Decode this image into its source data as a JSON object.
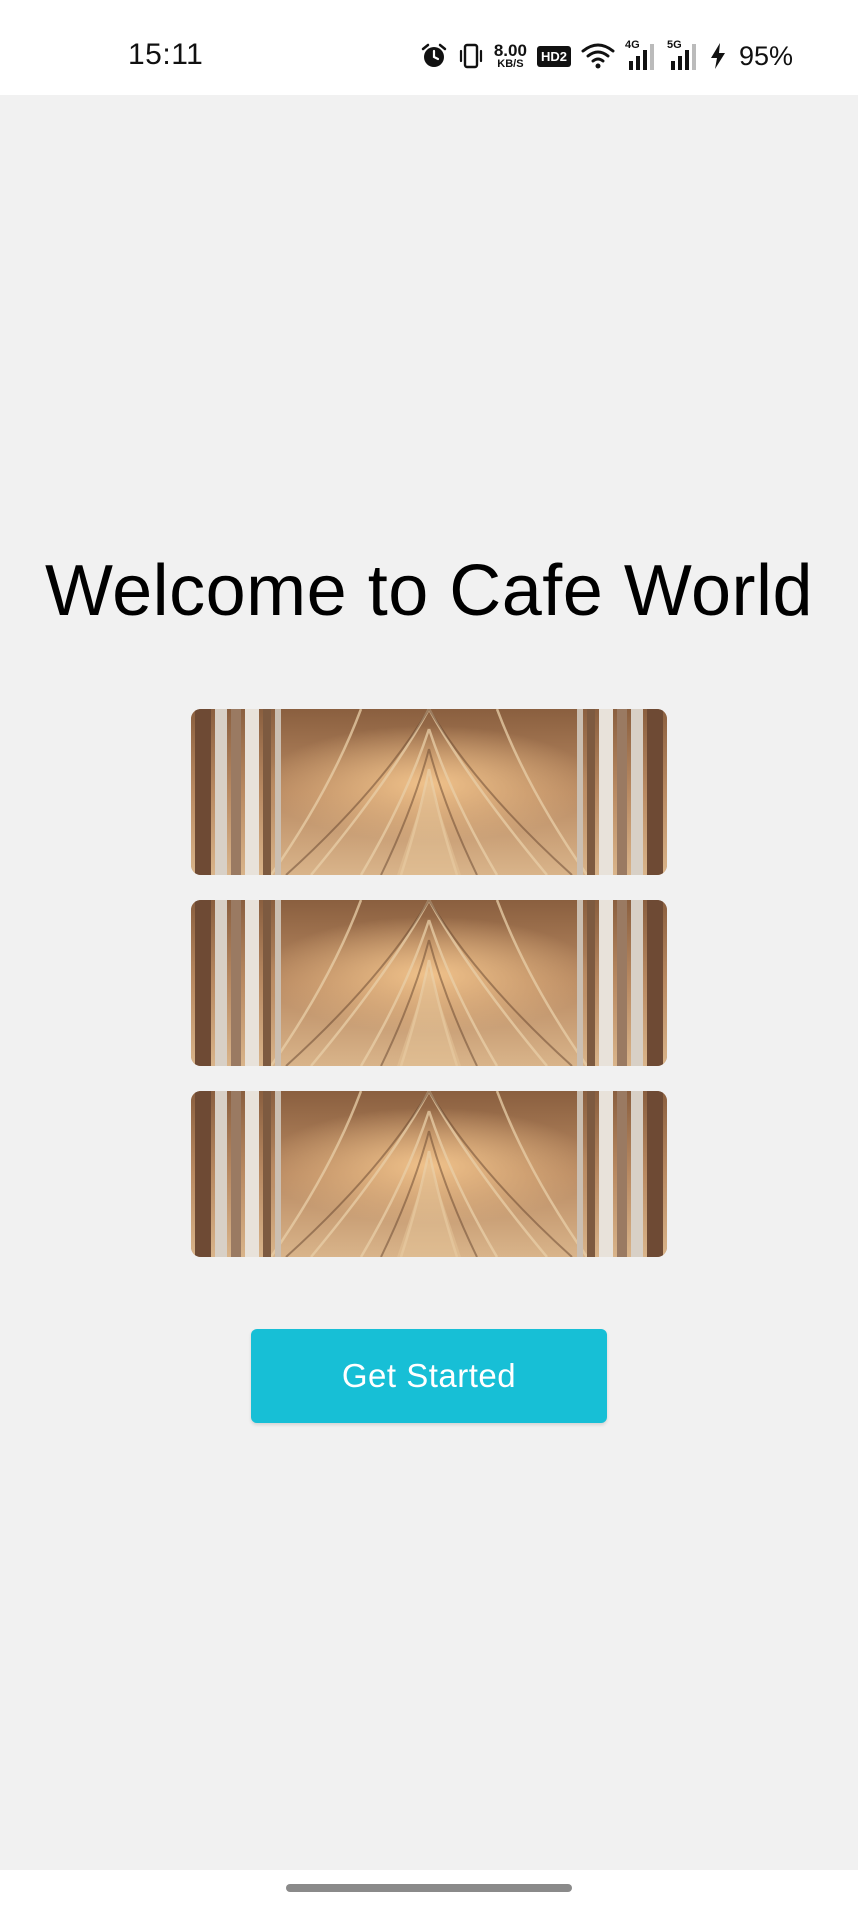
{
  "status_bar": {
    "time": "15:11",
    "net_speed_value": "8.00",
    "net_speed_unit": "KB/S",
    "hd_label": "HD2",
    "signal_1_label": "4G",
    "signal_2_label": "5G",
    "battery_percent": "95%",
    "icons": [
      "alarm-icon",
      "vibrate-icon",
      "wifi-icon",
      "signal-4g-icon",
      "signal-5g-icon",
      "charging-icon"
    ]
  },
  "main": {
    "title": "Welcome to Cafe World",
    "gallery_images": [
      {
        "image": "cathedral-interior-image"
      },
      {
        "image": "cathedral-interior-image"
      },
      {
        "image": "cathedral-interior-image"
      }
    ],
    "cta_label": "Get Started"
  },
  "colors": {
    "background": "#f1f1f1",
    "accent_button": "#17bfd6",
    "text": "#000000"
  }
}
